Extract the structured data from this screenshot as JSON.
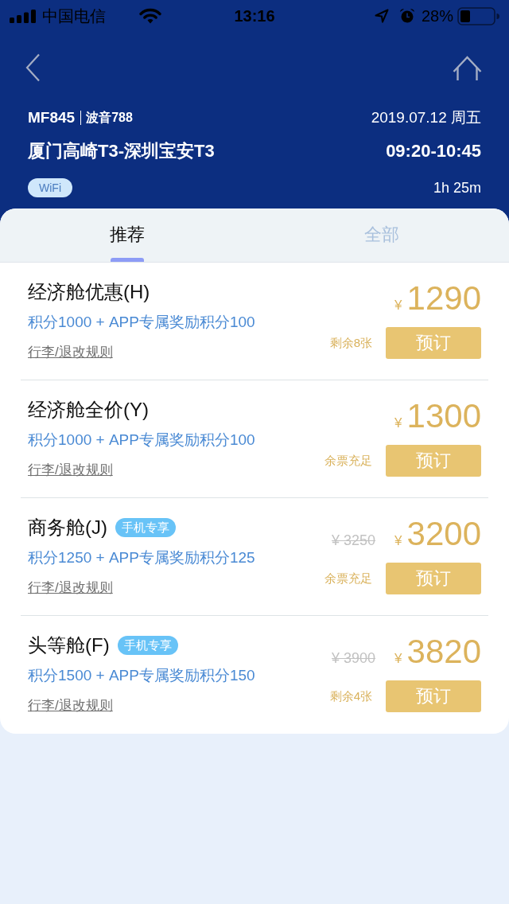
{
  "status_bar": {
    "carrier": "中国电信",
    "time": "13:16",
    "battery": "28%"
  },
  "flight": {
    "number": "MF845",
    "aircraft": "波音788",
    "date": "2019.07.12 周五",
    "route": "厦门高崎T3-深圳宝安T3",
    "times": "09:20-10:45",
    "tag": "WiFi",
    "duration": "1h 25m"
  },
  "tabs": [
    {
      "label": "推荐",
      "selected": true
    },
    {
      "label": "全部",
      "selected": false
    }
  ],
  "fares": [
    {
      "cabin": "经济舱优惠(H)",
      "points": "积分1000 + APP专属奖励积分100",
      "rules_link": "行李/退改规则",
      "currency": "¥",
      "price": "1290",
      "stock": "剩余8张",
      "button": "预订"
    },
    {
      "cabin": "经济舱全价(Y)",
      "points": "积分1000 + APP专属奖励积分100",
      "rules_link": "行李/退改规则",
      "currency": "¥",
      "price": "1300",
      "stock": "余票充足",
      "button": "预订"
    },
    {
      "cabin": "商务舱(J)",
      "badge": "手机专享",
      "points": "积分1250 + APP专属奖励积分125",
      "rules_link": "行李/退改规则",
      "original_price": "¥ 3250",
      "currency": "¥",
      "price": "3200",
      "stock": "余票充足",
      "button": "预订"
    },
    {
      "cabin": "头等舱(F)",
      "badge": "手机专享",
      "points": "积分1500 + APP专属奖励积分150",
      "rules_link": "行李/退改规则",
      "original_price": "¥ 3900",
      "currency": "¥",
      "price": "3820",
      "stock": "剩余4张",
      "button": "预订"
    }
  ]
}
